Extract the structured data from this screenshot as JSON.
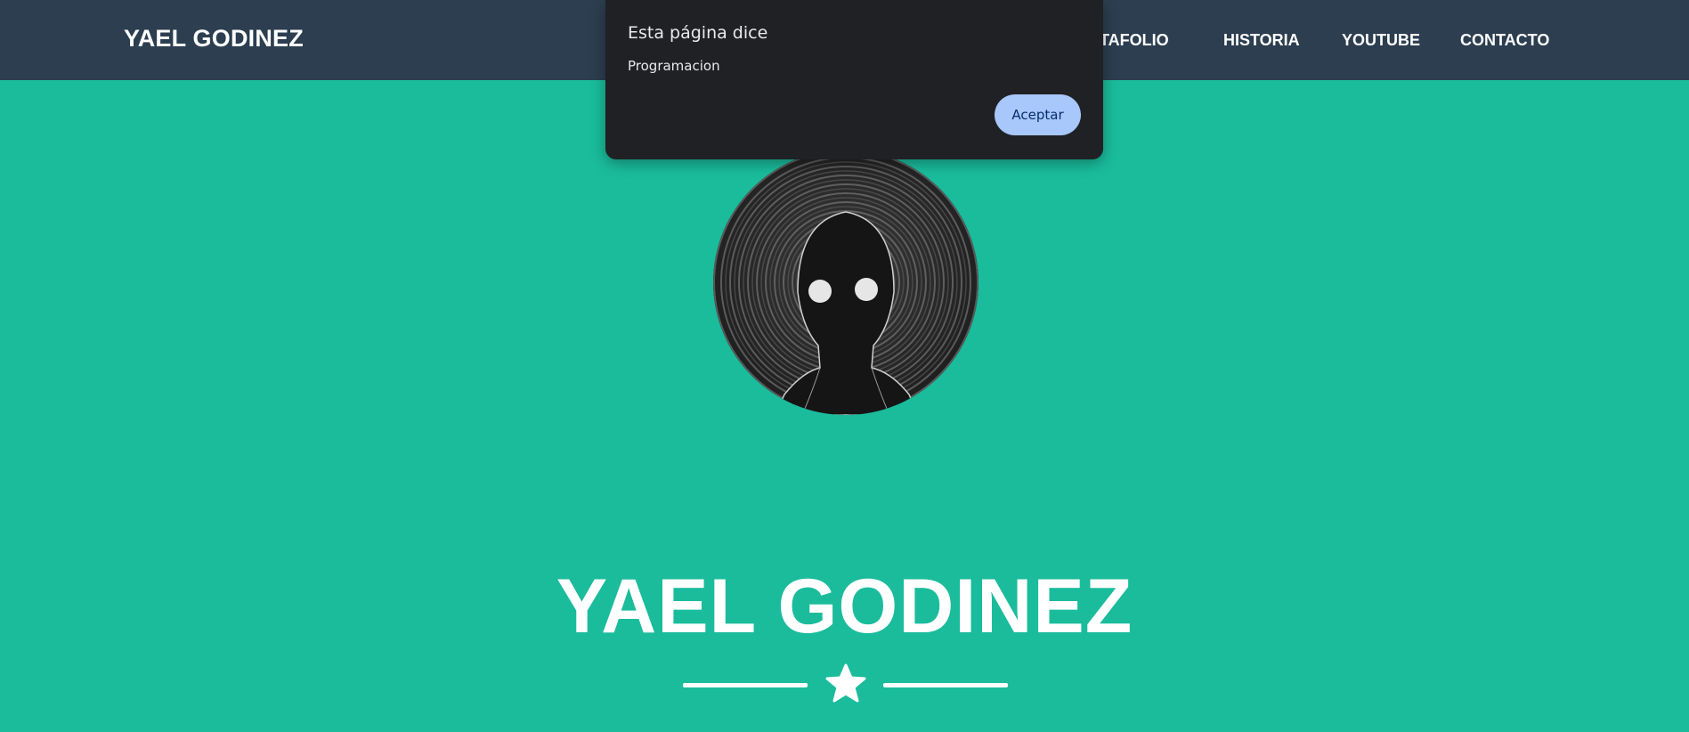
{
  "navbar": {
    "brand": "YAEL GODINEZ",
    "items": [
      {
        "label": "PORTAFOLIO"
      },
      {
        "label": "HISTORIA"
      },
      {
        "label": "YOUTUBE"
      },
      {
        "label": "CONTACTO"
      }
    ]
  },
  "hero": {
    "title": "YAEL GODINEZ",
    "avatar_alt": "dark-figure-avatar"
  },
  "dialog": {
    "title": "Esta página dice",
    "message": "Programacion",
    "button_label": "Aceptar"
  },
  "colors": {
    "background": "#1abc9c",
    "navbar": "#2c3e50",
    "dialog_bg": "#202124",
    "dialog_button": "#a8c7fa"
  }
}
